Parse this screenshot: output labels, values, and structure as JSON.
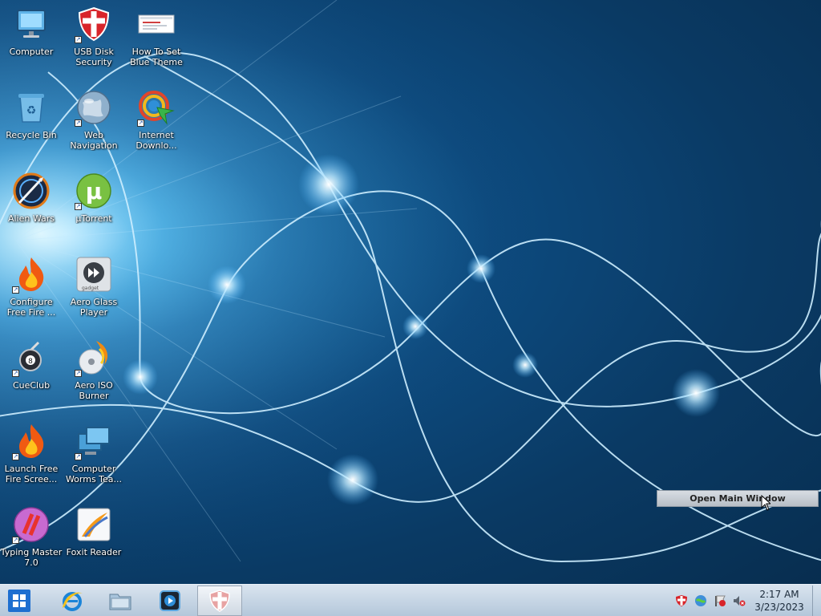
{
  "desktop": {
    "icons": [
      {
        "label": "Computer",
        "icon": "computer-icon"
      },
      {
        "label": "USB Disk\nSecurity",
        "icon": "shield-icon"
      },
      {
        "label": "How To Set\nBlue Theme ...",
        "icon": "document-thumbnail-icon"
      },
      {
        "label": "Recycle Bin",
        "icon": "recycle-bin-icon"
      },
      {
        "label": "Web\nNavigation",
        "icon": "globe-icon"
      },
      {
        "label": "Internet\nDownlo...",
        "icon": "download-manager-icon"
      },
      {
        "label": "Alien Wars",
        "icon": "alien-wars-icon"
      },
      {
        "label": "µTorrent",
        "icon": "utorrent-icon"
      },
      {
        "label": "Configure\nFree Fire ...",
        "icon": "flame-icon"
      },
      {
        "label": "Aero Glass\nPlayer",
        "icon": "media-player-gadget-icon"
      },
      {
        "label": "CueClub",
        "icon": "cueclub-icon"
      },
      {
        "label": "Aero ISO\nBurner",
        "icon": "disc-burner-icon"
      },
      {
        "label": "Launch Free\nFire Scree...",
        "icon": "flame-icon"
      },
      {
        "label": "Computer\nWorms Tea...",
        "icon": "monitors-icon"
      },
      {
        "label": "Typing Master\n7.0",
        "icon": "typing-master-icon"
      },
      {
        "label": "Foxit Reader",
        "icon": "foxit-reader-icon"
      }
    ]
  },
  "popup": {
    "label": "Open Main Window"
  },
  "taskbar": {
    "start_icon": "windows-logo-icon",
    "pinned": [
      {
        "name": "internet-explorer",
        "icon": "internet-explorer-icon"
      },
      {
        "name": "file-explorer",
        "icon": "folder-icon"
      },
      {
        "name": "media-player",
        "icon": "media-player-icon"
      },
      {
        "name": "usb-disk-security",
        "icon": "shield-icon",
        "active": true
      }
    ],
    "tray": [
      "shield-tray-icon",
      "network-tray-icon",
      "flag-tray-icon",
      "volume-muted-icon"
    ],
    "clock": {
      "time": "2:17 AM",
      "date": "3/23/2023"
    }
  }
}
